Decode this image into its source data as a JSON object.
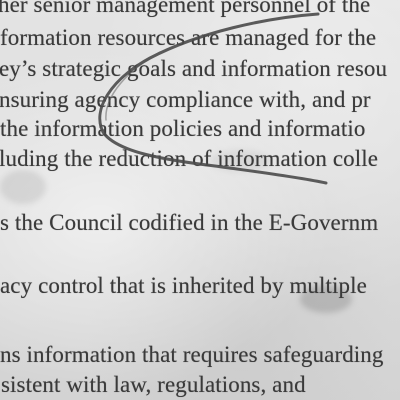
{
  "document": {
    "lines": [
      "her senior management personnel of the",
      "formation resources are managed for the",
      "ey’s strategic goals and information resou",
      "nsuring agency compliance with, and pr",
      "the information policies and informatio",
      "luding the reduction of information colle",
      "s the Council codified in the E-Governm",
      "acy control that is inherited by multiple",
      "ns information that requires safeguarding",
      "sistent with law, regulations, and"
    ]
  },
  "annotation": {
    "type": "handwritten-pen-stroke",
    "color": "#4a4a4a"
  }
}
